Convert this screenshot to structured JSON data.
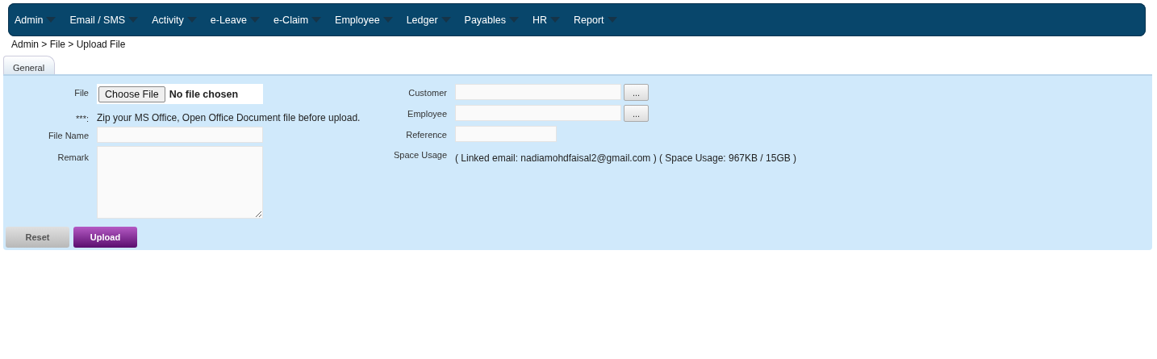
{
  "menu": [
    {
      "label": "Admin"
    },
    {
      "label": "Email / SMS"
    },
    {
      "label": "Activity"
    },
    {
      "label": "e-Leave"
    },
    {
      "label": "e-Claim"
    },
    {
      "label": "Employee"
    },
    {
      "label": "Ledger"
    },
    {
      "label": "Payables"
    },
    {
      "label": "HR"
    },
    {
      "label": "Report"
    }
  ],
  "breadcrumb": "Admin > File > Upload File",
  "tabs": [
    {
      "label": "General",
      "selected": true
    }
  ],
  "form": {
    "left": [
      {
        "kind": "file",
        "label": "File",
        "button": "Choose File",
        "value": "No file chosen"
      },
      {
        "kind": "note",
        "label": "***:",
        "text": "Zip your MS Office, Open Office Document file before upload."
      },
      {
        "kind": "text",
        "label": "File Name"
      },
      {
        "kind": "textarea",
        "label": "Remark"
      }
    ],
    "right": [
      {
        "kind": "lookup",
        "label": "Customer",
        "button": "..."
      },
      {
        "kind": "lookup",
        "label": "Employee",
        "button": "..."
      },
      {
        "kind": "short",
        "label": "Reference"
      },
      {
        "kind": "info",
        "label": "Space Usage",
        "text": "( Linked email: nadiamohdfaisal2@gmail.com ) ( Space Usage: 967KB / 15GB )"
      }
    ]
  },
  "buttons": [
    {
      "label": "Reset",
      "kind": "secondary"
    },
    {
      "label": "Upload",
      "kind": "primary"
    }
  ]
}
